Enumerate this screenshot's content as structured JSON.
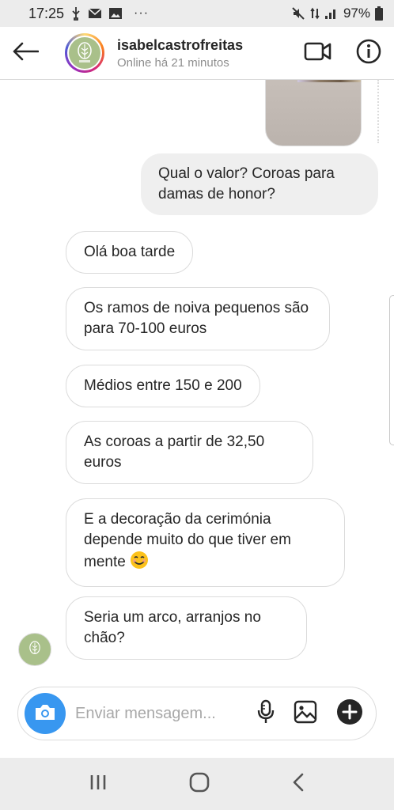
{
  "status_bar": {
    "time": "17:25",
    "extra": "···",
    "battery": "97%"
  },
  "header": {
    "username": "isabelcastrofreitas",
    "status": "Online há 21 minutos"
  },
  "messages": [
    {
      "type": "sent",
      "text": "Qual o valor? Coroas para damas de honor?"
    },
    {
      "type": "received",
      "text": "Olá boa tarde"
    },
    {
      "type": "received",
      "text": "Os ramos de noiva pequenos são para 70-100 euros"
    },
    {
      "type": "received",
      "text": "Médios entre 150 e 200"
    },
    {
      "type": "received",
      "text": "As coroas a partir de 32,50 euros"
    },
    {
      "type": "received",
      "text": "E a decoração da cerimónia depende muito do que tiver em mente",
      "emoji": "😊"
    },
    {
      "type": "received",
      "text": "Seria um arco, arranjos no chão?"
    }
  ],
  "composer": {
    "placeholder": "Enviar mensagem..."
  },
  "icons": {
    "back": "back-arrow-icon",
    "video": "video-call-icon",
    "info": "info-icon",
    "camera": "camera-icon",
    "mic": "microphone-icon",
    "gallery": "gallery-icon",
    "add": "plus-icon",
    "nav_recent": "recent-apps-icon",
    "nav_home": "home-icon",
    "nav_back": "nav-back-icon"
  },
  "colors": {
    "accent": "#3897f0",
    "sent_bubble": "#efefef",
    "received_border": "#dbdbdb",
    "avatar_bg": "#a9c08a"
  }
}
